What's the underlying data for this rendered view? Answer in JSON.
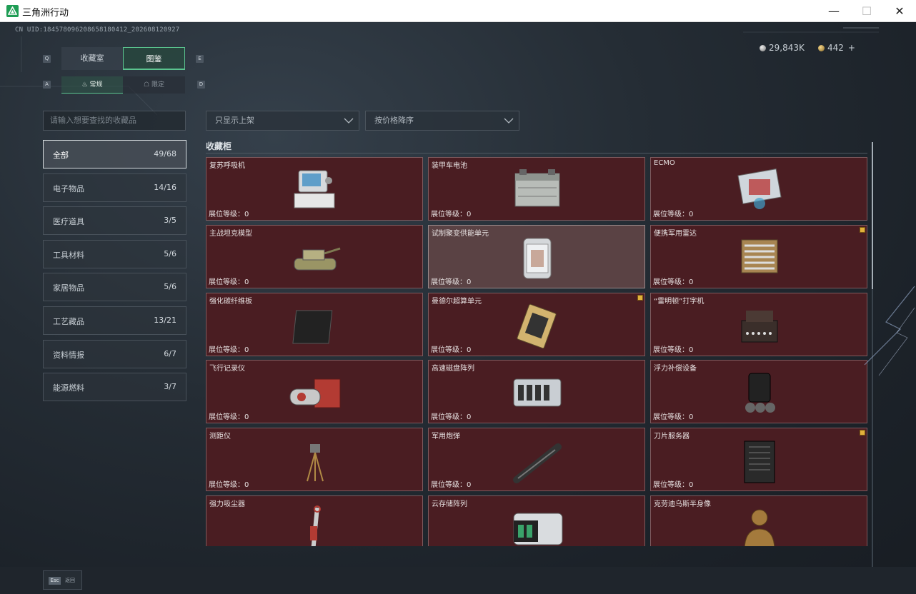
{
  "window": {
    "title": "三角洲行动",
    "min": "—",
    "max": "☐",
    "close": "✕"
  },
  "uid": "CN UID:1845780962086581804​12_202608120927",
  "currency": [
    {
      "value": "29,843K",
      "color": "#bdbdbd"
    },
    {
      "value": "442",
      "plus": "+",
      "color": "#d4a648"
    }
  ],
  "tabs": {
    "key_left": "Q",
    "key_right": "E",
    "items": [
      {
        "label": "收藏室"
      },
      {
        "label": "图鉴"
      }
    ],
    "active": "图鉴"
  },
  "subtabs": {
    "key_left": "A",
    "key_right": "D",
    "items": [
      {
        "label": "常规"
      },
      {
        "label": "限定"
      }
    ],
    "active": "常规"
  },
  "search": {
    "placeholder": "请输入想要查找的收藏品"
  },
  "filters": {
    "shelf": "只显示上架",
    "sort": "按价格降序"
  },
  "categories": [
    {
      "label": "全部",
      "count": "49/68",
      "active": true
    },
    {
      "label": "电子物品",
      "count": "14/16"
    },
    {
      "label": "医疗道具",
      "count": "3/5"
    },
    {
      "label": "工具材料",
      "count": "5/6"
    },
    {
      "label": "家居物品",
      "count": "5/6"
    },
    {
      "label": "工艺藏品",
      "count": "13/21"
    },
    {
      "label": "资料情报",
      "count": "6/7"
    },
    {
      "label": "能源燃料",
      "count": "3/7"
    }
  ],
  "section_title": "收藏柜",
  "level_label": "展位等级：0",
  "items": [
    {
      "name": "复苏呼吸机",
      "icon": "ventilator-icon"
    },
    {
      "name": "装甲车电池",
      "icon": "battery-icon"
    },
    {
      "name": "ECMO",
      "icon": "ecmo-icon"
    },
    {
      "name": "主战坦克模型",
      "icon": "tank-model-icon"
    },
    {
      "name": "试制聚变供能单元",
      "icon": "fusion-unit-icon",
      "highlight": true
    },
    {
      "name": "便携军用雷达",
      "icon": "radar-icon",
      "badge": true
    },
    {
      "name": "强化碳纤维板",
      "icon": "carbon-plate-icon"
    },
    {
      "name": "曼德尔超算单元",
      "icon": "supercomputer-icon",
      "badge": true
    },
    {
      "name": "“雷明顿”打字机",
      "icon": "typewriter-icon"
    },
    {
      "name": "飞行记录仪",
      "icon": "flight-recorder-icon"
    },
    {
      "name": "高速磁盘阵列",
      "icon": "disk-array-icon"
    },
    {
      "name": "浮力补偿设备",
      "icon": "buoyancy-device-icon"
    },
    {
      "name": "测距仪",
      "icon": "rangefinder-icon"
    },
    {
      "name": "军用炮弹",
      "icon": "artillery-shell-icon"
    },
    {
      "name": "刀片服务器",
      "icon": "blade-server-icon",
      "badge": true
    },
    {
      "name": "强力吸尘器",
      "icon": "vacuum-icon"
    },
    {
      "name": "云存储阵列",
      "icon": "cloud-storage-icon"
    },
    {
      "name": "克劳迪乌斯半身像",
      "icon": "bust-icon"
    }
  ],
  "back": {
    "key": "Esc",
    "label": "返回"
  }
}
